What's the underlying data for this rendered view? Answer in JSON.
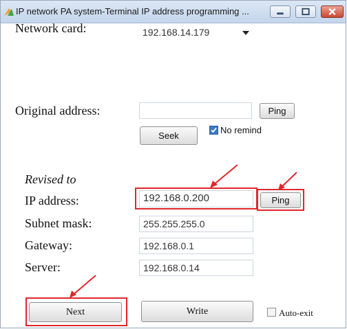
{
  "window": {
    "title": "IP network PA system-Terminal IP address programming ...",
    "controls": {
      "minimize": "minimize-icon",
      "maximize": "maximize-icon",
      "close": "close-icon"
    }
  },
  "network_card": {
    "label": "Network card:",
    "selected": "192.168.14.179"
  },
  "original": {
    "label": "Original address:",
    "value": "",
    "ping_label": "Ping",
    "seek_label": "Seek",
    "no_remind_label": "No remind",
    "no_remind_checked": true
  },
  "revised": {
    "heading": "Revised to",
    "ip_label": "IP address:",
    "ip_value": "192.168.0.200",
    "ping_label": "Ping",
    "subnet_label": "Subnet mask:",
    "subnet_value": "255.255.255.0",
    "gateway_label": "Gateway:",
    "gateway_value": "192.168.0.1",
    "server_label": "Server:",
    "server_value": "192.168.0.14"
  },
  "footer": {
    "next_label": "Next",
    "write_label": "Write",
    "auto_exit_label": "Auto-exit",
    "auto_exit_checked": false
  },
  "colors": {
    "highlight": "#e0262a",
    "titlebar": "#c4d6ec",
    "check": "#3c78c5"
  }
}
